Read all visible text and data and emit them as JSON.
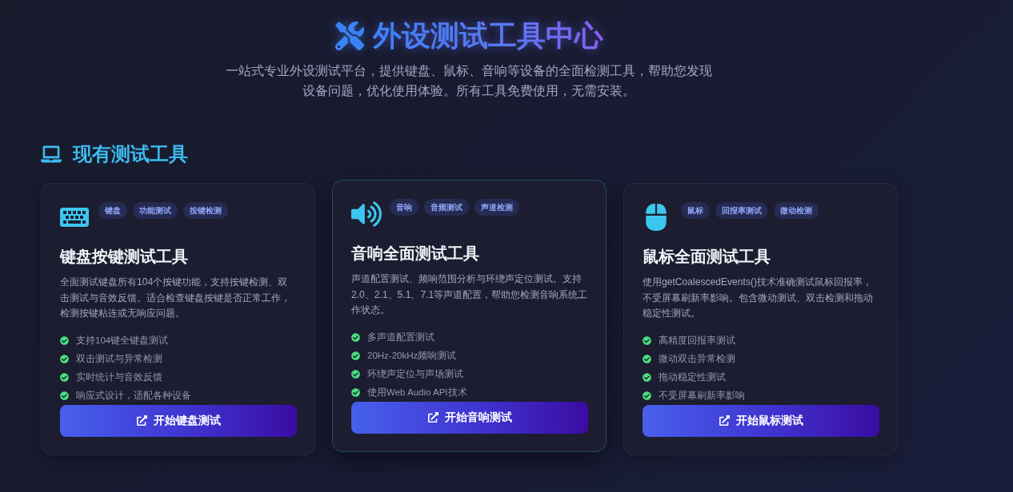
{
  "header": {
    "title": "外设测试工具中心",
    "subtitle": "一站式专业外设测试平台，提供键盘、鼠标、音响等设备的全面检测工具，帮助您发现设备问题，优化使用体验。所有工具免费使用，无需安装。"
  },
  "section": {
    "title": "现有测试工具"
  },
  "cards": [
    {
      "kind": "keyboard",
      "hovered": false,
      "tags": [
        "键盘",
        "功能测试",
        "按键检测"
      ],
      "title": "键盘按键测试工具",
      "description": "全面测试键盘所有104个按键功能，支持按键检测、双击测试与音效反馈。适合检查键盘按键是否正常工作，检测按键粘连或无响应问题。",
      "features": [
        "支持104键全键盘测试",
        "双击测试与异常检测",
        "实时统计与音效反馈",
        "响应式设计，适配各种设备"
      ],
      "button": "开始键盘测试"
    },
    {
      "kind": "speaker",
      "hovered": true,
      "tags": [
        "音响",
        "音频测试",
        "声道检测"
      ],
      "title": "音响全面测试工具",
      "description": "声道配置测试、频响范围分析与环绕声定位测试。支持2.0、2.1、5.1、7.1等声道配置，帮助您检测音响系统工作状态。",
      "features": [
        "多声道配置测试",
        "20Hz-20kHz频响测试",
        "环绕声定位与声场测试",
        "使用Web Audio API技术"
      ],
      "button": "开始音响测试"
    },
    {
      "kind": "mouse",
      "hovered": false,
      "tags": [
        "鼠标",
        "回报率测试",
        "微动检测"
      ],
      "title": "鼠标全面测试工具",
      "description": "使用getCoalescedEvents()技术准确测试鼠标回报率，不受屏幕刷新率影响。包含微动测试、双击检测和拖动稳定性测试。",
      "features": [
        "高精度回报率测试",
        "微动双击异常检测",
        "拖动稳定性测试",
        "不受屏幕刷新率影响"
      ],
      "button": "开始鼠标测试"
    }
  ]
}
